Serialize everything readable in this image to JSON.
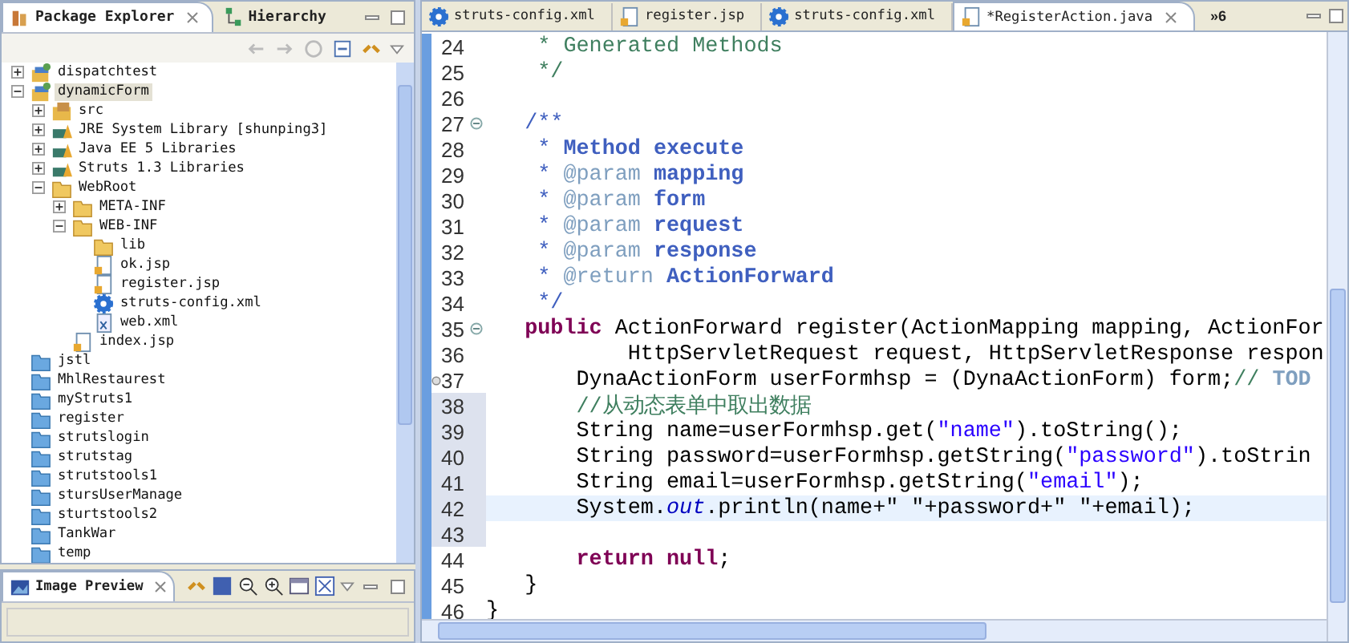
{
  "explorer": {
    "tabs": [
      {
        "label": "Package Explorer",
        "selected": true,
        "kind": "package"
      },
      {
        "label": "Hierarchy",
        "selected": false,
        "kind": "hierarchy"
      }
    ],
    "tree": [
      {
        "label": "dispatchtest",
        "kind": "project",
        "expanded": false,
        "selected": false
      },
      {
        "label": "dynamicForm",
        "kind": "project",
        "expanded": true,
        "selected": true,
        "children": [
          {
            "label": "src",
            "kind": "source",
            "expanded": false,
            "selected": false
          },
          {
            "label": "JRE System Library [shunping3]",
            "kind": "library",
            "expanded": false,
            "selected": false
          },
          {
            "label": "Java EE 5 Libraries",
            "kind": "library",
            "expanded": false,
            "selected": false
          },
          {
            "label": "Struts 1.3 Libraries",
            "kind": "library",
            "expanded": false,
            "selected": false
          },
          {
            "label": "WebRoot",
            "kind": "folder",
            "expanded": true,
            "selected": false,
            "children": [
              {
                "label": "META-INF",
                "kind": "folder",
                "expanded": false,
                "selected": false
              },
              {
                "label": "WEB-INF",
                "kind": "folder",
                "expanded": true,
                "selected": false,
                "children": [
                  {
                    "label": "lib",
                    "kind": "folder",
                    "selected": false
                  },
                  {
                    "label": "ok.jsp",
                    "kind": "jsp",
                    "selected": false
                  },
                  {
                    "label": "register.jsp",
                    "kind": "jsp",
                    "selected": false
                  },
                  {
                    "label": "struts-config.xml",
                    "kind": "config",
                    "selected": false
                  },
                  {
                    "label": "web.xml",
                    "kind": "xml",
                    "selected": false
                  }
                ]
              },
              {
                "label": "index.jsp",
                "kind": "jsp",
                "selected": false
              }
            ]
          }
        ]
      },
      {
        "label": "jstl",
        "kind": "closed",
        "selected": false
      },
      {
        "label": "MhlRestaurest",
        "kind": "closed",
        "selected": false
      },
      {
        "label": "myStruts1",
        "kind": "closed",
        "selected": false
      },
      {
        "label": "register",
        "kind": "closed",
        "selected": false
      },
      {
        "label": "strutslogin",
        "kind": "closed",
        "selected": false
      },
      {
        "label": "strutstag",
        "kind": "closed",
        "selected": false
      },
      {
        "label": "strutstools1",
        "kind": "closed",
        "selected": false
      },
      {
        "label": "stursUserManage",
        "kind": "closed",
        "selected": false
      },
      {
        "label": "sturtstools2",
        "kind": "closed",
        "selected": false
      },
      {
        "label": "TankWar",
        "kind": "closed",
        "selected": false
      },
      {
        "label": "temp",
        "kind": "closed",
        "selected": false
      }
    ]
  },
  "preview": {
    "tab": {
      "label": "Image Preview",
      "selected": true
    }
  },
  "editor": {
    "tabs": [
      {
        "label": "struts-config.xml",
        "kind": "config",
        "selected": false
      },
      {
        "label": "register.jsp",
        "kind": "jsp",
        "selected": false
      },
      {
        "label": "struts-config.xml",
        "kind": "config",
        "selected": false
      },
      {
        "label": "*RegisterAction.java",
        "kind": "java",
        "selected": true
      }
    ],
    "overflow": "»6",
    "lines": [
      {
        "number": "24",
        "changed": false,
        "current": false,
        "tokens": [
          {
            "kind": "comment",
            "text": "    * Generated Methods"
          }
        ]
      },
      {
        "number": "25",
        "changed": false,
        "current": false,
        "tokens": [
          {
            "kind": "comment",
            "text": "    */"
          }
        ]
      },
      {
        "number": "26",
        "changed": false,
        "current": false
      },
      {
        "number": "27",
        "changed": false,
        "current": false,
        "fold": true,
        "tokens": [
          {
            "kind": "doc",
            "text": "   /**"
          }
        ]
      },
      {
        "number": "28",
        "changed": false,
        "current": false,
        "tokens": [
          {
            "kind": "doc",
            "text": "    * "
          },
          {
            "kind": "docbold",
            "text": "Method execute"
          }
        ]
      },
      {
        "number": "29",
        "changed": false,
        "current": false,
        "tokens": [
          {
            "kind": "doc",
            "text": "    * "
          },
          {
            "kind": "tag",
            "text": "@param"
          },
          {
            "kind": "docbold",
            "text": " mapping"
          }
        ]
      },
      {
        "number": "30",
        "changed": false,
        "current": false,
        "tokens": [
          {
            "kind": "doc",
            "text": "    * "
          },
          {
            "kind": "tag",
            "text": "@param"
          },
          {
            "kind": "docbold",
            "text": " form"
          }
        ]
      },
      {
        "number": "31",
        "changed": false,
        "current": false,
        "tokens": [
          {
            "kind": "doc",
            "text": "    * "
          },
          {
            "kind": "tag",
            "text": "@param"
          },
          {
            "kind": "docbold",
            "text": " request"
          }
        ]
      },
      {
        "number": "32",
        "changed": false,
        "current": false,
        "tokens": [
          {
            "kind": "doc",
            "text": "    * "
          },
          {
            "kind": "tag",
            "text": "@param"
          },
          {
            "kind": "docbold",
            "text": " response"
          }
        ]
      },
      {
        "number": "33",
        "changed": false,
        "current": false,
        "tokens": [
          {
            "kind": "doc",
            "text": "    * "
          },
          {
            "kind": "tag",
            "text": "@return"
          },
          {
            "kind": "docbold",
            "text": " ActionForward"
          }
        ]
      },
      {
        "number": "34",
        "changed": false,
        "current": false,
        "tokens": [
          {
            "kind": "doc",
            "text": "    */"
          }
        ]
      },
      {
        "number": "35",
        "changed": false,
        "current": false,
        "fold": true,
        "tokens": [
          {
            "kind": "keyword",
            "text": "   public"
          },
          {
            "kind": "plain",
            "text": " ActionForward register(ActionMapping mapping, ActionFor"
          }
        ]
      },
      {
        "number": "36",
        "changed": false,
        "current": false,
        "tokens": [
          {
            "kind": "plain",
            "text": "           HttpServletRequest request, HttpServletResponse respon"
          }
        ]
      },
      {
        "number": "37",
        "changed": false,
        "current": false,
        "marker": true,
        "tokens": [
          {
            "kind": "plain",
            "text": "       DynaActionForm userFormhsp = (DynaActionForm) form;"
          },
          {
            "kind": "linecomment",
            "text": "// "
          },
          {
            "kind": "todo",
            "text": "TOD"
          }
        ]
      },
      {
        "number": "38",
        "changed": true,
        "current": false,
        "tokens": [
          {
            "kind": "linecomment",
            "text": "       //从动态表单中取出数据"
          }
        ]
      },
      {
        "number": "39",
        "changed": true,
        "current": false,
        "tokens": [
          {
            "kind": "plain",
            "text": "       String name=userFormhsp.get("
          },
          {
            "kind": "string",
            "text": "\"name\""
          },
          {
            "kind": "plain",
            "text": ").toString();"
          }
        ]
      },
      {
        "number": "40",
        "changed": true,
        "current": false,
        "tokens": [
          {
            "kind": "plain",
            "text": "       String password=userFormhsp.getString("
          },
          {
            "kind": "string",
            "text": "\"password\""
          },
          {
            "kind": "plain",
            "text": ").toStrin"
          }
        ]
      },
      {
        "number": "41",
        "changed": true,
        "current": false,
        "tokens": [
          {
            "kind": "plain",
            "text": "       String email=userFormhsp.getString("
          },
          {
            "kind": "string",
            "text": "\"email\""
          },
          {
            "kind": "plain",
            "text": ");"
          }
        ]
      },
      {
        "number": "42",
        "changed": true,
        "current": true,
        "tokens": [
          {
            "kind": "plain",
            "text": "       System."
          },
          {
            "kind": "static",
            "text": "out"
          },
          {
            "kind": "plain",
            "text": ".println(name+\" \"+password+\" \"+email);"
          }
        ]
      },
      {
        "number": "43",
        "changed": true,
        "current": false
      },
      {
        "number": "44",
        "changed": false,
        "current": false,
        "tokens": [
          {
            "kind": "keyword",
            "text": "       return null"
          },
          {
            "kind": "plain",
            "text": ";"
          }
        ]
      },
      {
        "number": "45",
        "changed": false,
        "current": false,
        "tokens": [
          {
            "kind": "plain",
            "text": "   }"
          }
        ]
      },
      {
        "number": "46",
        "changed": false,
        "current": false,
        "tokens": [
          {
            "kind": "plain",
            "text": "}"
          }
        ]
      }
    ]
  }
}
